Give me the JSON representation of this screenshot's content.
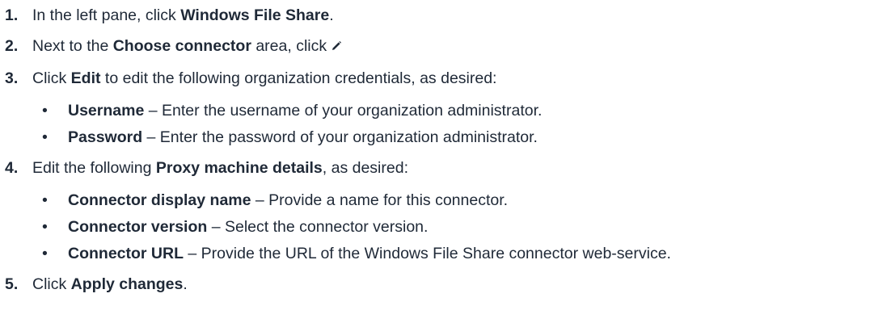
{
  "steps": [
    {
      "num": "1.",
      "pre": "In the left pane, click ",
      "bold": "Windows File Share",
      "post": "."
    },
    {
      "num": "2.",
      "pre": "Next to the ",
      "bold": "Choose connector",
      "post": " area, click",
      "icon": "pencil-icon"
    },
    {
      "num": "3.",
      "pre": "Click ",
      "bold": "Edit",
      "post": " to edit the following organization credentials, as desired:",
      "items": [
        {
          "bold": "Username",
          "text": " – Enter the username of your organization administrator."
        },
        {
          "bold": "Password",
          "text": " – Enter the password of your organization administrator."
        }
      ]
    },
    {
      "num": "4.",
      "pre": "Edit the following ",
      "bold": "Proxy machine details",
      "post": ", as desired:",
      "items": [
        {
          "bold": "Connector display name",
          "text": " – Provide a name for this connector."
        },
        {
          "bold": "Connector version",
          "text": " – Select the connector version."
        },
        {
          "bold": "Connector URL",
          "text": " – Provide the URL of the Windows File Share connector web-service."
        }
      ]
    },
    {
      "num": "5.",
      "pre": "Click ",
      "bold": "Apply changes",
      "post": "."
    }
  ],
  "bullet_char": "•"
}
